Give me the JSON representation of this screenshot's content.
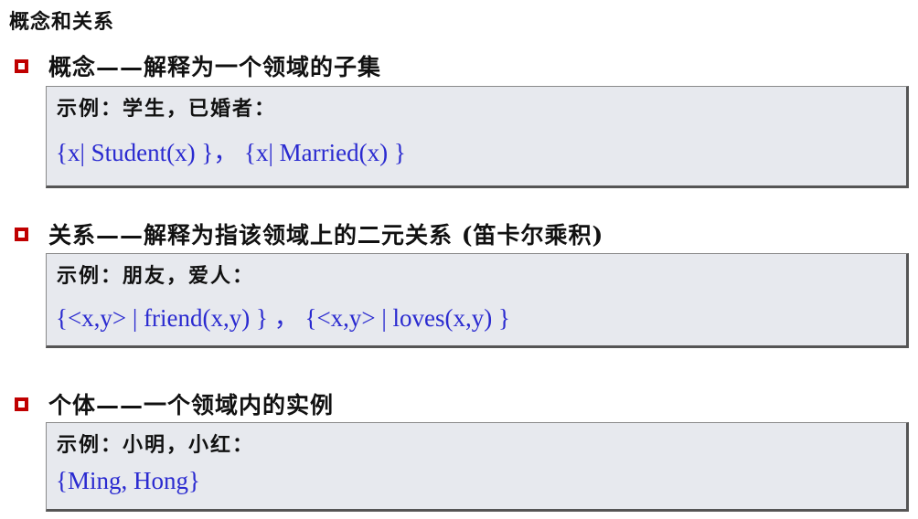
{
  "heading": "概念和关系",
  "sections": [
    {
      "title": "概念——解释为一个领域的子集",
      "example_label": "示例：学生，已婚者：",
      "formula": "{x| Student(x) }， {x| Married(x) }"
    },
    {
      "title": "关系——解释为指该领域上的二元关系 (笛卡尔乘积)",
      "example_label": "示例：朋友，爱人：",
      "formula": "{<x,y> | friend(x,y) } ， {<x,y> | loves(x,y) }"
    },
    {
      "title": "个体——一个领域内的实例",
      "example_label": "示例：小明，小红：",
      "formula": "{Ming, Hong}"
    }
  ],
  "colors": {
    "bullet": "#c00000",
    "formula": "#2a2ad0",
    "box_background": "#e7e9ee"
  }
}
